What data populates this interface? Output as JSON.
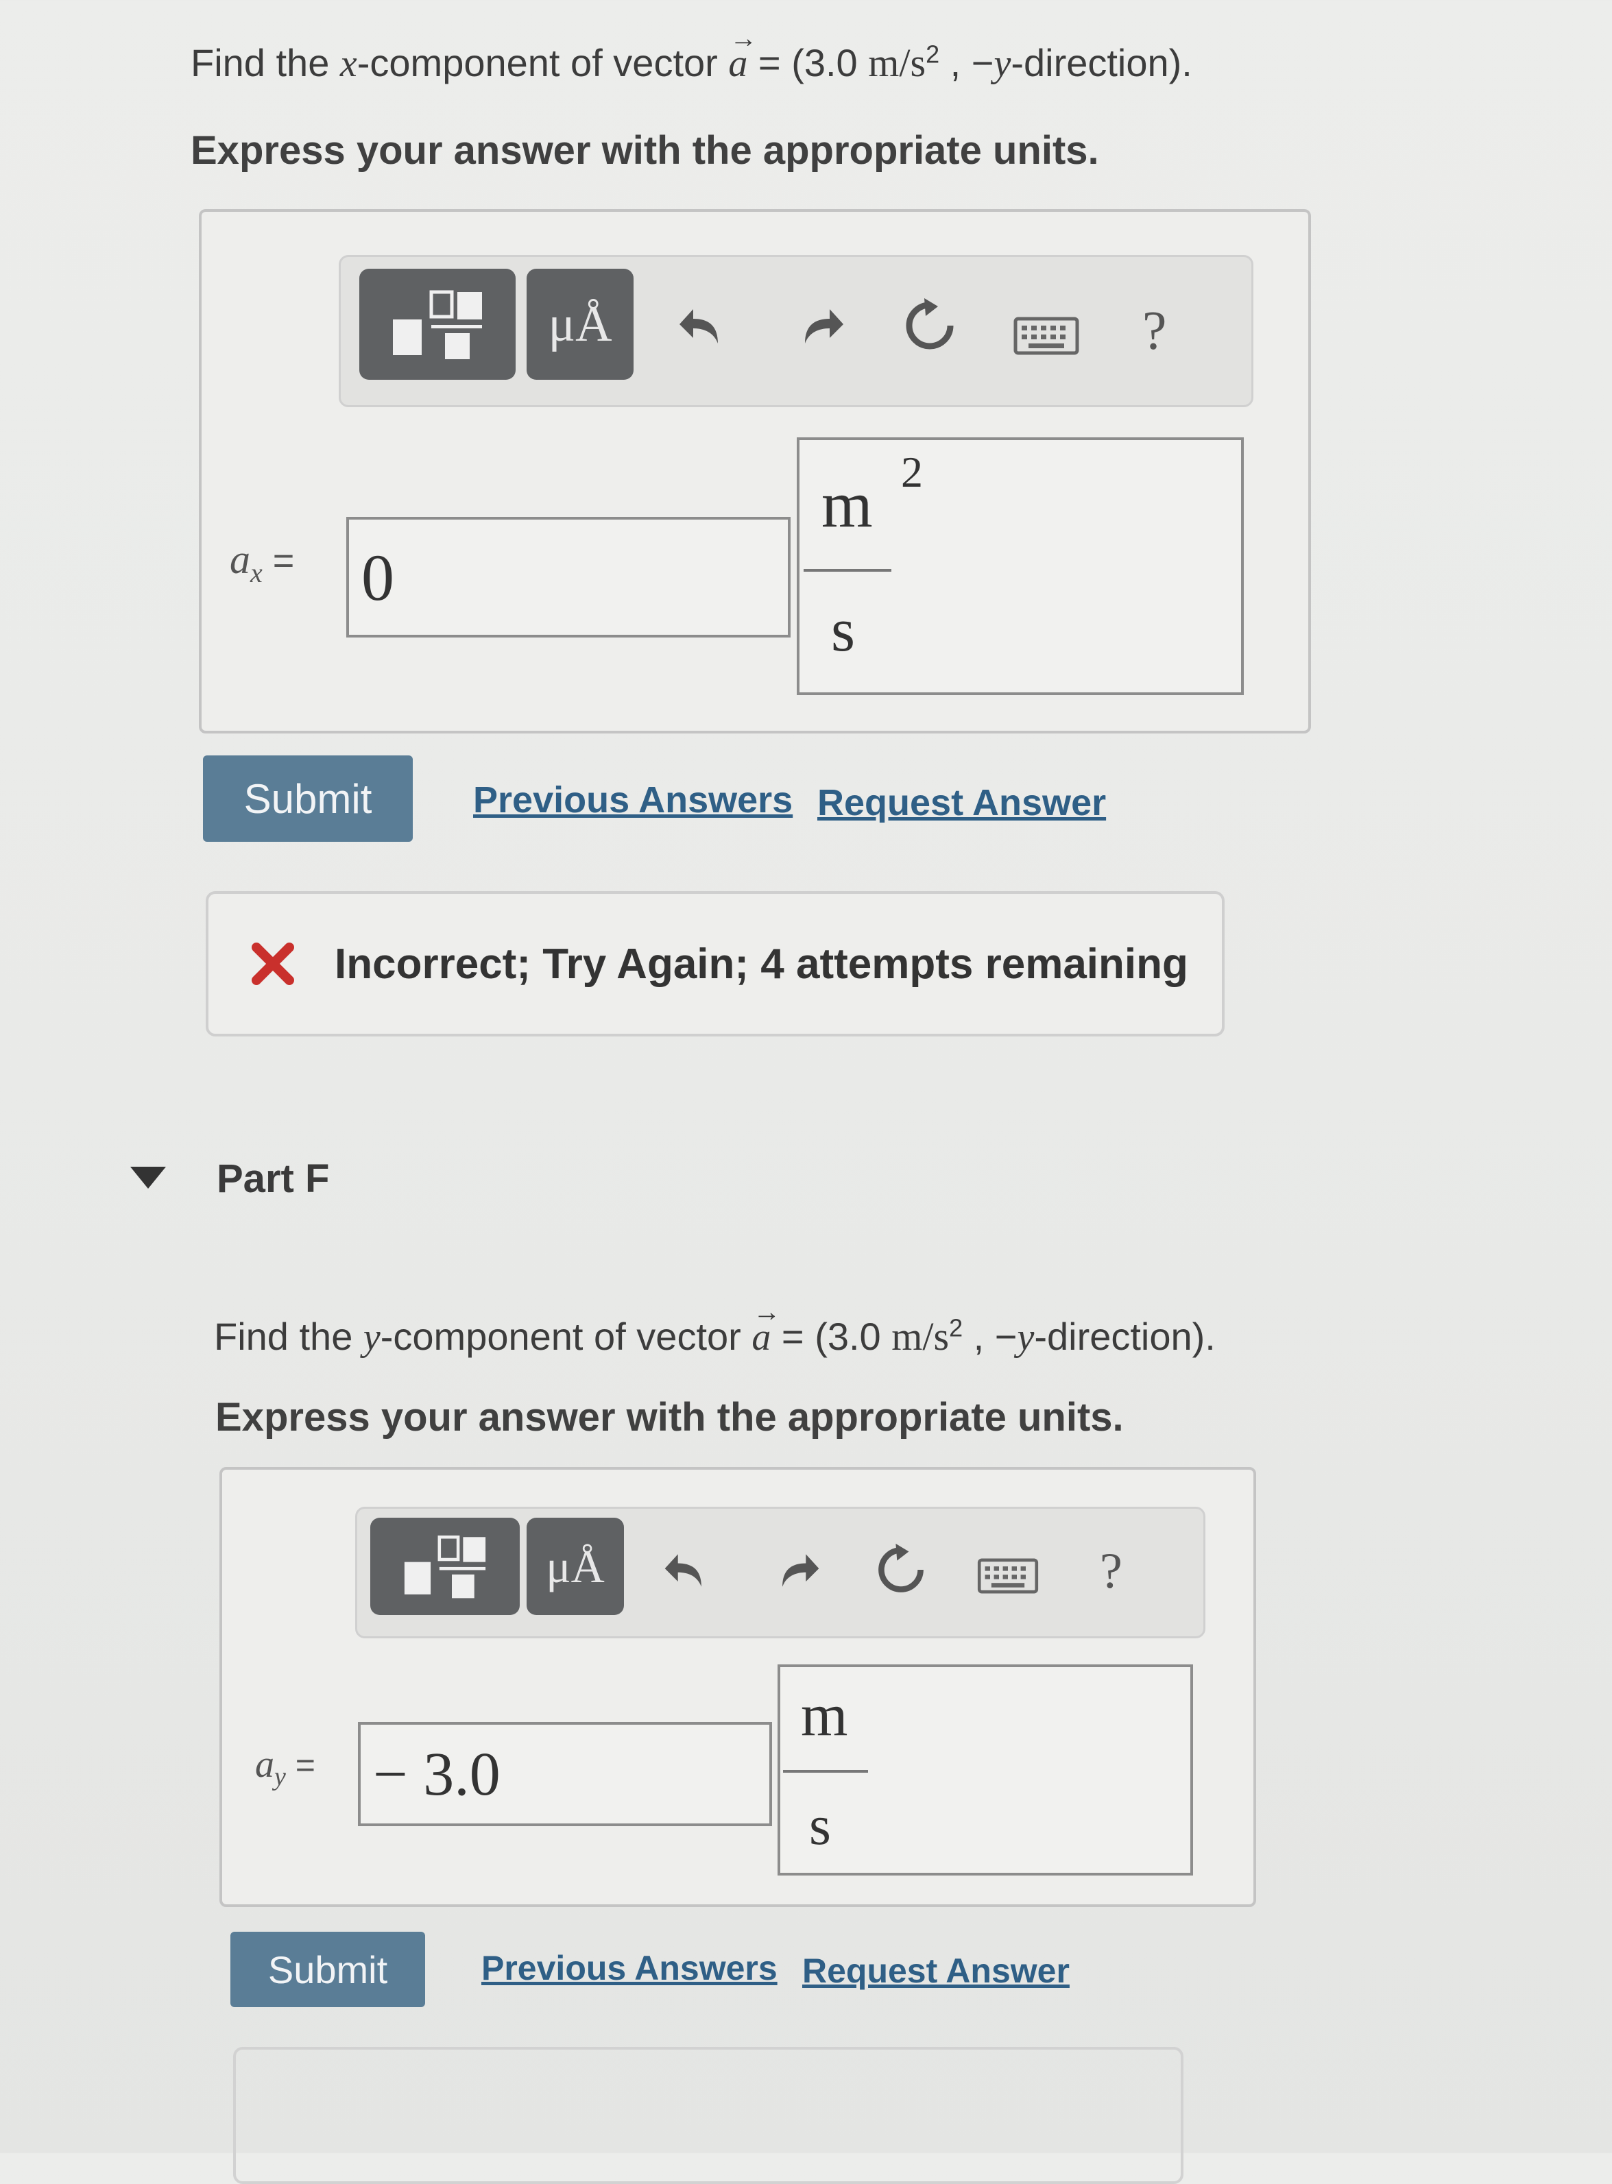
{
  "part_e": {
    "prompt_text": "Find the ",
    "prompt_var": "x",
    "prompt_text2": "-component of vector ",
    "vec": "a",
    "eq_open": " = (3.0 ",
    "vec_unit": "m/s",
    "sup": "2",
    "direction": " , −",
    "dir_var": "y",
    "dir_text": "-direction).",
    "instruction": "Express your answer with the appropriate units.",
    "toolbar": {
      "units_label": "μÅ",
      "help": "?"
    },
    "var_label": "a",
    "var_sub": "x",
    "eq": " =",
    "input_value": "0",
    "unit_num": "m",
    "unit_den": "s",
    "unit_exp": "2",
    "submit": "Submit",
    "prev_answers": "Previous Answers",
    "request_answer": "Request Answer",
    "feedback": "Incorrect; Try Again; 4 attempts remaining"
  },
  "part_f": {
    "title": "Part F",
    "prompt_text": "Find the ",
    "prompt_var": "y",
    "prompt_text2": "-component of vector ",
    "vec": "a",
    "eq_open": " = (3.0 ",
    "vec_unit": "m/s",
    "sup": "2",
    "direction": " , −",
    "dir_var": "y",
    "dir_text": "-direction).",
    "instruction": "Express your answer with the appropriate units.",
    "toolbar": {
      "units_label": "μÅ",
      "help": "?"
    },
    "var_label": "a",
    "var_sub": "y",
    "eq": " =",
    "input_value": "− 3.0",
    "unit_num": "m",
    "unit_den": "s",
    "submit": "Submit",
    "prev_answers": "Previous Answers",
    "request_answer": "Request Answer"
  },
  "colors": {
    "submit_bg": "#5a7d96",
    "link": "#2f5f86",
    "error": "#c9302c"
  }
}
